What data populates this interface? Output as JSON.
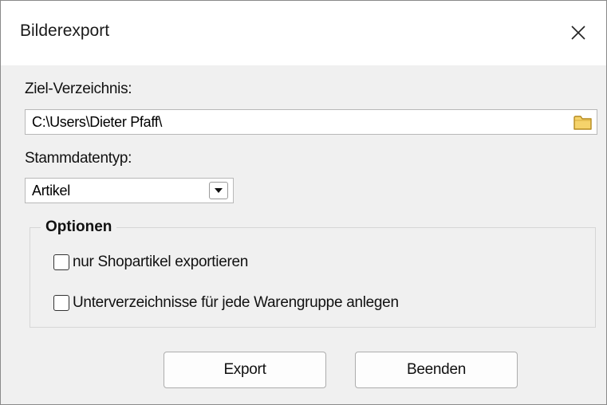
{
  "window": {
    "title": "Bilderexport"
  },
  "target": {
    "label": "Ziel-Verzeichnis:",
    "value": "C:\\Users\\Dieter Pfaff\\"
  },
  "masterdata": {
    "label": "Stammdatentyp:",
    "selected": "Artikel"
  },
  "options": {
    "title": "Optionen",
    "items": [
      {
        "label": "nur Shopartikel exportieren",
        "checked": false
      },
      {
        "label": "Unterverzeichnisse für jede Warengruppe anlegen",
        "checked": false
      }
    ]
  },
  "buttons": {
    "export": "Export",
    "close": "Beenden"
  },
  "icons": {
    "close": "close-icon",
    "folder": "folder-icon",
    "dropdown": "dropdown-arrow-icon"
  },
  "colors": {
    "dialog_bg": "#f0f0f0",
    "folder": "#f5d36b"
  }
}
